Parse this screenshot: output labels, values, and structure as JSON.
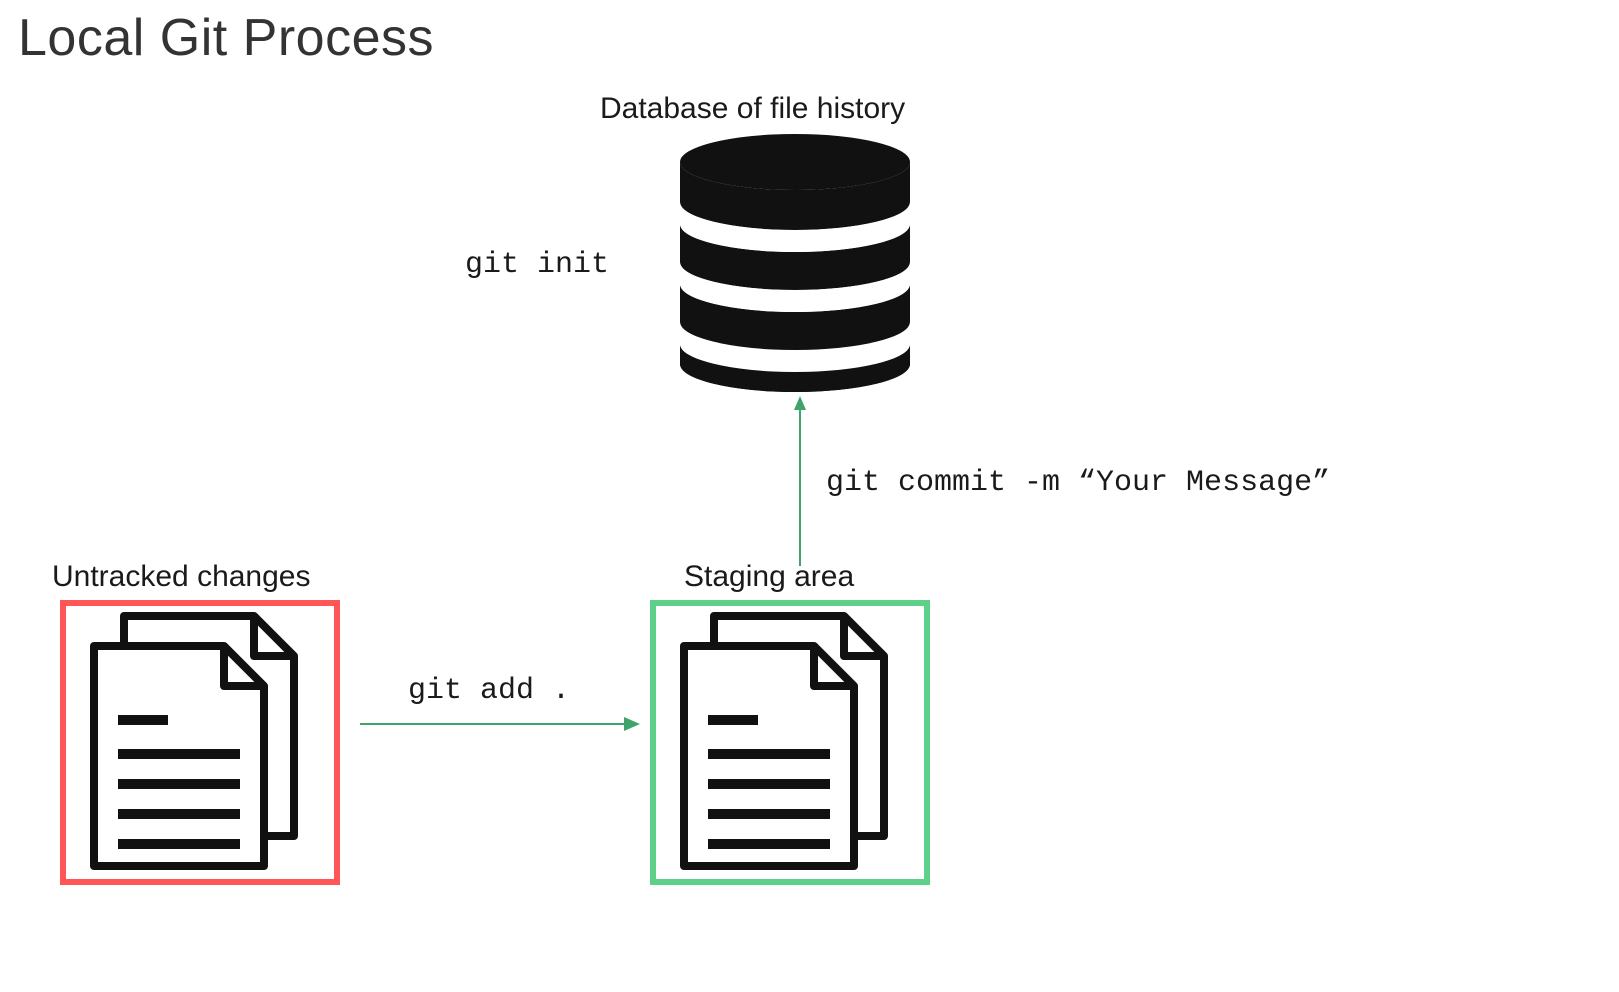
{
  "title": "Local Git Process",
  "database_label": "Database of file history",
  "init_cmd": "git init",
  "commit_cmd": "git commit -m “Your Message”",
  "untracked_label": "Untracked changes",
  "staging_label": "Staging area",
  "add_cmd": "git add .",
  "colors": {
    "untracked_border": "#ff5757",
    "staging_border": "#5fd08a",
    "arrow": "#3fa36a"
  }
}
